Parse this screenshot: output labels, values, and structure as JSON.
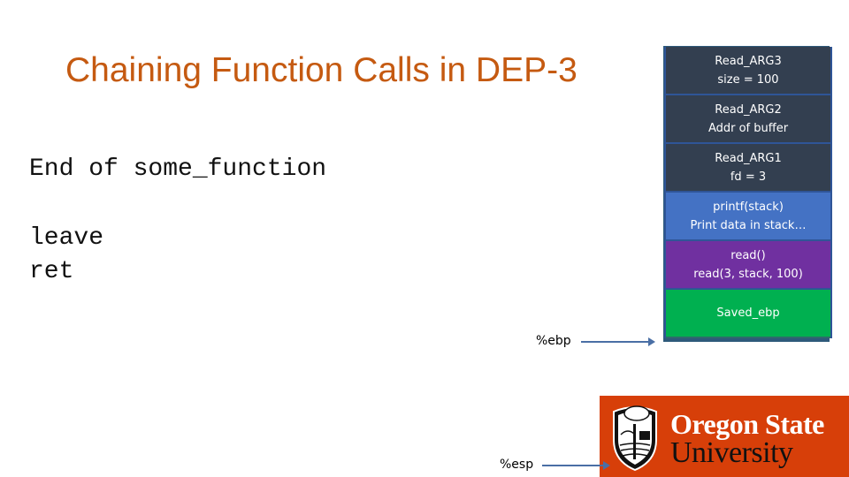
{
  "slide": {
    "title": "Chaining Function Calls in DEP-3",
    "code_heading": "End of some_function",
    "code_lines": [
      "leave",
      "ret"
    ]
  },
  "stack": [
    {
      "line1": "Read_ARG3",
      "line2": "size = 100",
      "color": "#333f50"
    },
    {
      "line1": "Read_ARG2",
      "line2": "Addr of buffer",
      "color": "#333f50"
    },
    {
      "line1": "Read_ARG1",
      "line2": "fd = 3",
      "color": "#333f50"
    },
    {
      "line1": "printf(stack)",
      "line2": "Print data in stack…",
      "color": "#4472c4"
    },
    {
      "line1": "read()",
      "line2": "read(3, stack, 100)",
      "color": "#7030a0"
    },
    {
      "line1": "Saved_ebp",
      "line2": "",
      "color": "#00b050"
    }
  ],
  "registers": {
    "ebp": "%ebp",
    "esp": "%esp"
  },
  "logo": {
    "line1": "Oregon State",
    "line2": "University",
    "icon": "osu-beaver-crest-icon",
    "bg_color": "#d73f09"
  }
}
